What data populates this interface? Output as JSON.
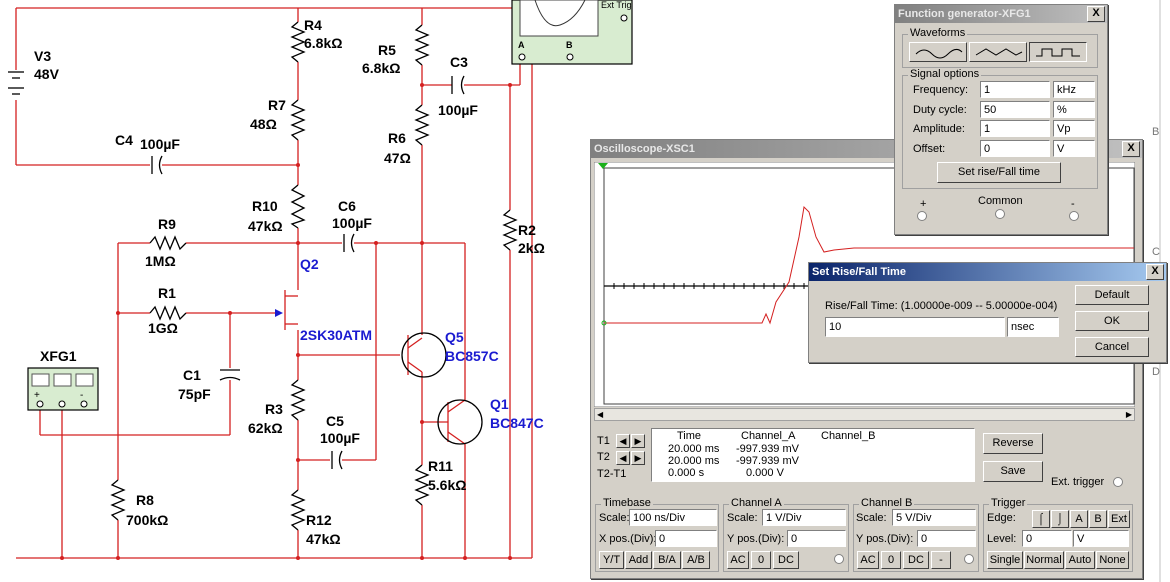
{
  "schematic": {
    "components": [
      {
        "ref": "V3",
        "value": "48V"
      },
      {
        "ref": "R4",
        "value": "6.8kΩ"
      },
      {
        "ref": "R5",
        "value": "6.8kΩ"
      },
      {
        "ref": "C3",
        "value": "100µF"
      },
      {
        "ref": "R7",
        "value": "48Ω"
      },
      {
        "ref": "R6",
        "value": "47Ω"
      },
      {
        "ref": "C4",
        "value": "100µF"
      },
      {
        "ref": "R10",
        "value": "47kΩ"
      },
      {
        "ref": "C6",
        "value": "100µF"
      },
      {
        "ref": "R9",
        "value": "1MΩ"
      },
      {
        "ref": "R2",
        "value": "2kΩ"
      },
      {
        "ref": "Q2",
        "value": ""
      },
      {
        "ref": "R1",
        "value": "1GΩ"
      },
      {
        "ref": "2SK30ATM",
        "value": ""
      },
      {
        "ref": "Q5",
        "value": "BC857C"
      },
      {
        "ref": "C1",
        "value": "75pF"
      },
      {
        "ref": "Q1",
        "value": "BC847C"
      },
      {
        "ref": "R3",
        "value": "62kΩ"
      },
      {
        "ref": "C5",
        "value": "100µF"
      },
      {
        "ref": "R11",
        "value": "5.6kΩ"
      },
      {
        "ref": "R8",
        "value": "700kΩ"
      },
      {
        "ref": "R12",
        "value": "47kΩ"
      }
    ],
    "xfg_label": "XFG1",
    "xfg_terminals": [
      "+",
      "-"
    ],
    "scope_top_labels": {
      "ext_trig": "Ext Trig",
      "a": "A",
      "b": "B"
    },
    "ruler": [
      "B",
      "C",
      "D"
    ]
  },
  "oscilloscope": {
    "title": "Oscilloscope-XSC1",
    "close": "X",
    "readout": {
      "headers": [
        "Time",
        "Channel_A",
        "Channel_B"
      ],
      "rows": [
        {
          "label": "T1",
          "time": "20.000 ms",
          "a": "-997.939 mV",
          "b": ""
        },
        {
          "label": "T2",
          "time": "20.000 ms",
          "a": "-997.939 mV",
          "b": ""
        },
        {
          "label": "T2-T1",
          "time": "0.000 s",
          "a": "0.000 V",
          "b": ""
        }
      ]
    },
    "buttons": {
      "reverse": "Reverse",
      "save": "Save",
      "ext_trigger": "Ext. trigger"
    },
    "timebase": {
      "title": "Timebase",
      "scale_label": "Scale:",
      "scale": "100 ns/Div",
      "xpos_label": "X pos.(Div):",
      "xpos": "0",
      "modes": [
        "Y/T",
        "Add",
        "B/A",
        "A/B"
      ]
    },
    "channel_a": {
      "title": "Channel A",
      "scale_label": "Scale:",
      "scale": "1  V/Div",
      "ypos_label": "Y pos.(Div):",
      "ypos": "0",
      "coupling": [
        "AC",
        "0",
        "DC"
      ]
    },
    "channel_b": {
      "title": "Channel B",
      "scale_label": "Scale:",
      "scale": "5  V/Div",
      "ypos_label": "Y pos.(Div):",
      "ypos": "0",
      "coupling": [
        "AC",
        "0",
        "DC",
        "-"
      ]
    },
    "trigger": {
      "title": "Trigger",
      "edge_label": "Edge:",
      "edge_options": [
        "A",
        "B",
        "Ext"
      ],
      "level_label": "Level:",
      "level": "0",
      "level_unit": "V",
      "modes": [
        "Single",
        "Normal",
        "Auto",
        "None"
      ]
    }
  },
  "function_generator": {
    "title": "Function generator-XFG1",
    "close": "X",
    "waveforms_label": "Waveforms",
    "signal_options_label": "Signal options",
    "options": [
      {
        "label": "Frequency:",
        "value": "1",
        "unit": "kHz"
      },
      {
        "label": "Duty cycle:",
        "value": "50",
        "unit": "%"
      },
      {
        "label": "Amplitude:",
        "value": "1",
        "unit": "Vp"
      },
      {
        "label": "Offset:",
        "value": "0",
        "unit": "V"
      }
    ],
    "rise_fall_button": "Set rise/Fall time",
    "terminals": {
      "plus": "+",
      "common": "Common",
      "minus": "-"
    }
  },
  "rise_fall_dialog": {
    "title": "Set Rise/Fall Time",
    "close": "X",
    "label": "Rise/Fall Time: (1.00000e-009 -- 5.00000e-004)",
    "value": "10",
    "unit": "nsec",
    "buttons": {
      "default": "Default",
      "ok": "OK",
      "cancel": "Cancel"
    }
  }
}
